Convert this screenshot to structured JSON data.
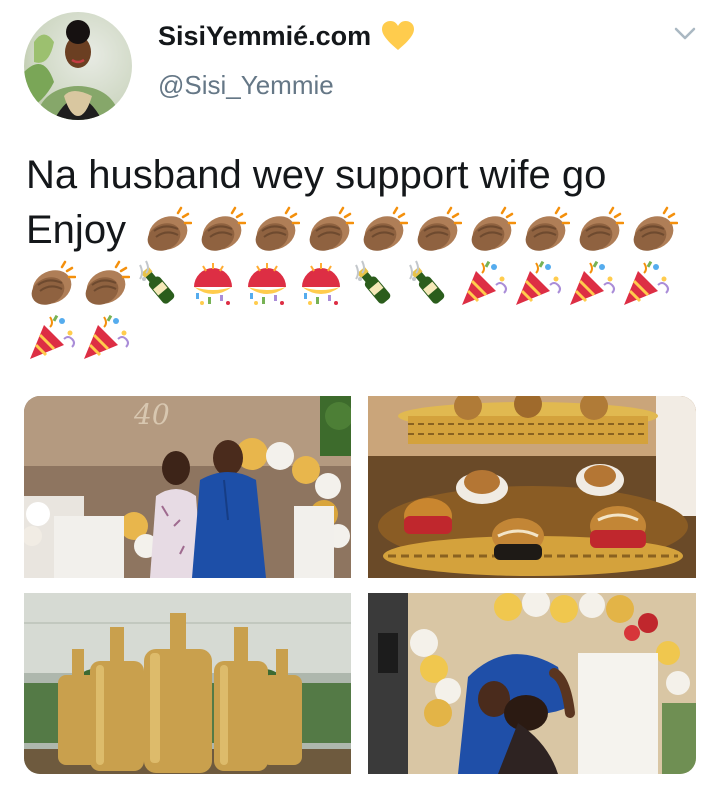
{
  "user": {
    "display_name": "SisiYemmié.com",
    "handle": "@Sisi_Yemmie",
    "badge_icon": "yellow-heart-icon"
  },
  "tweet": {
    "text_line1": "Na husband wey support wife go",
    "text_word2": "Enjoy",
    "emoji_sequence": [
      "clapping-hands",
      "clapping-hands",
      "clapping-hands",
      "clapping-hands",
      "clapping-hands",
      "clapping-hands",
      "clapping-hands",
      "clapping-hands",
      "clapping-hands",
      "clapping-hands",
      "clapping-hands",
      "clapping-hands",
      "champagne",
      "confetti-ball",
      "confetti-ball",
      "confetti-ball",
      "champagne",
      "champagne",
      "party-popper",
      "party-popper",
      "party-popper",
      "party-popper",
      "party-popper",
      "party-popper"
    ]
  },
  "media": [
    {
      "id": "photo-couple-40th"
    },
    {
      "id": "photo-dessert-stand"
    },
    {
      "id": "photo-gold-bottles"
    },
    {
      "id": "photo-couple-embrace"
    }
  ],
  "colors": {
    "text": "#14171a",
    "secondary": "#657786",
    "heart": "#ffcc4d",
    "skin": "#af7e57"
  }
}
